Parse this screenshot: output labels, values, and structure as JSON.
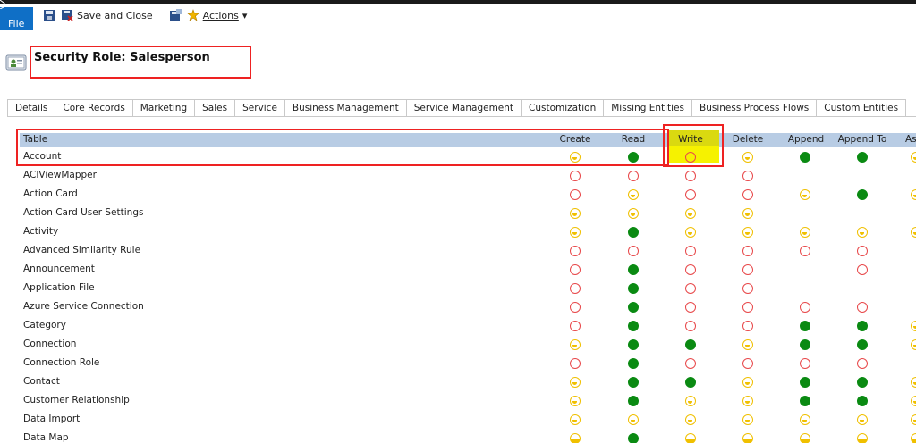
{
  "ribbon": {
    "file_label": "File",
    "save_close_label": "Save and Close",
    "actions_label": "Actions",
    "actions_caret": "▾"
  },
  "header": {
    "title": "Security Role: Salesperson"
  },
  "tabs": [
    {
      "label": "Details"
    },
    {
      "label": "Core Records"
    },
    {
      "label": "Marketing"
    },
    {
      "label": "Sales"
    },
    {
      "label": "Service"
    },
    {
      "label": "Business Management"
    },
    {
      "label": "Service Management"
    },
    {
      "label": "Customization"
    },
    {
      "label": "Missing Entities"
    },
    {
      "label": "Business Process Flows"
    },
    {
      "label": "Custom Entities"
    }
  ],
  "grid": {
    "columns": [
      "Table",
      "Create",
      "Read",
      "Write",
      "Delete",
      "Append",
      "Append To",
      "As"
    ],
    "rows": [
      {
        "table": "Account",
        "cells": [
          "user",
          "org",
          "none",
          "user",
          "org",
          "org",
          "user"
        ]
      },
      {
        "table": "ACIViewMapper",
        "cells": [
          "none",
          "none",
          "none",
          "none",
          "",
          "",
          ""
        ]
      },
      {
        "table": "Action Card",
        "cells": [
          "none",
          "user",
          "none",
          "none",
          "user",
          "org",
          "user"
        ]
      },
      {
        "table": "Action Card User Settings",
        "cells": [
          "user",
          "user",
          "user",
          "user",
          "",
          "",
          ""
        ]
      },
      {
        "table": "Activity",
        "cells": [
          "user",
          "org",
          "user",
          "user",
          "user",
          "user",
          "user"
        ]
      },
      {
        "table": "Advanced Similarity Rule",
        "cells": [
          "none",
          "none",
          "none",
          "none",
          "none",
          "none",
          ""
        ]
      },
      {
        "table": "Announcement",
        "cells": [
          "none",
          "org",
          "none",
          "none",
          "",
          "none",
          ""
        ]
      },
      {
        "table": "Application File",
        "cells": [
          "none",
          "org",
          "none",
          "none",
          "",
          "",
          ""
        ]
      },
      {
        "table": "Azure Service Connection",
        "cells": [
          "none",
          "org",
          "none",
          "none",
          "none",
          "none",
          ""
        ]
      },
      {
        "table": "Category",
        "cells": [
          "none",
          "org",
          "none",
          "none",
          "org",
          "org",
          "user"
        ]
      },
      {
        "table": "Connection",
        "cells": [
          "user",
          "org",
          "org",
          "user",
          "org",
          "org",
          "user"
        ]
      },
      {
        "table": "Connection Role",
        "cells": [
          "none",
          "org",
          "none",
          "none",
          "none",
          "none",
          ""
        ]
      },
      {
        "table": "Contact",
        "cells": [
          "user",
          "org",
          "org",
          "user",
          "org",
          "org",
          "user"
        ]
      },
      {
        "table": "Customer Relationship",
        "cells": [
          "user",
          "org",
          "user",
          "user",
          "org",
          "org",
          "user"
        ]
      },
      {
        "table": "Data Import",
        "cells": [
          "user",
          "user",
          "user",
          "user",
          "user",
          "user",
          "user"
        ]
      },
      {
        "table": "Data Map",
        "cells": [
          "bu",
          "org",
          "bu",
          "bu",
          "bu",
          "bu",
          "bu"
        ]
      }
    ]
  },
  "legend_colors": {
    "none": "#e8484a",
    "user": "#f0c000",
    "organization": "#0a8a12",
    "highlight": "#f6f200",
    "annotation_box": "#e22222"
  },
  "icons": {
    "save": "save-icon",
    "save_close": "save-close-icon",
    "save_new": "save-new-icon",
    "actions": "actions-icon",
    "entity": "security-role-icon"
  }
}
